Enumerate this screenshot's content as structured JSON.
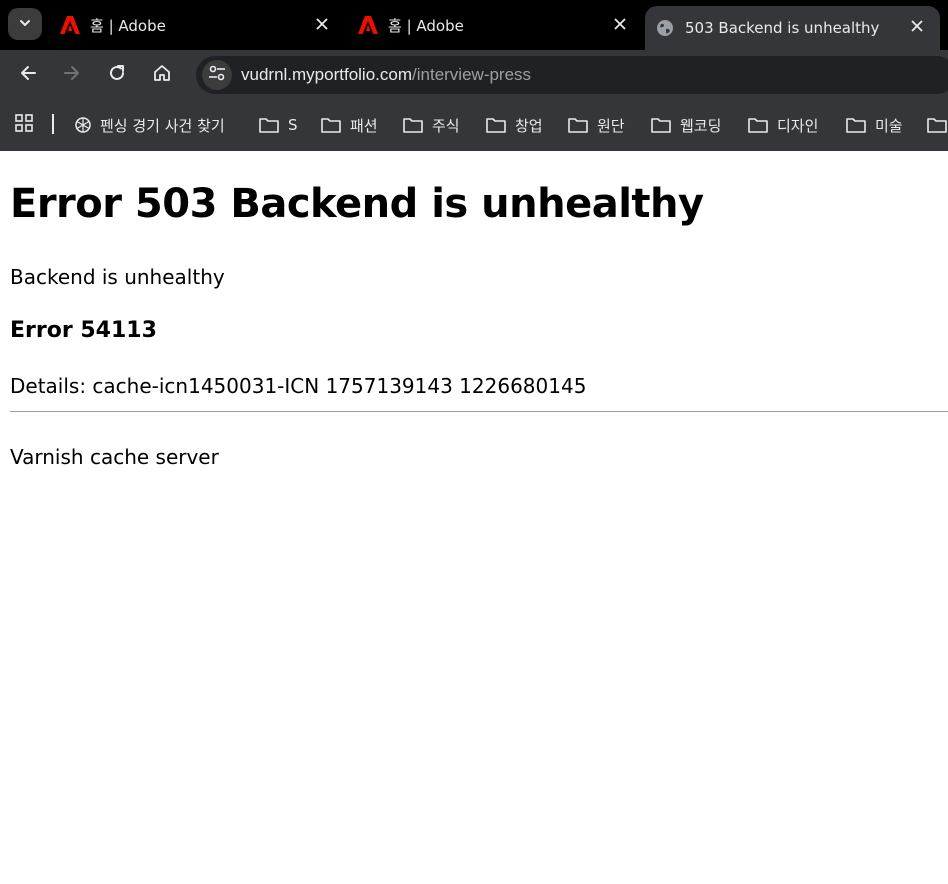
{
  "browser": {
    "tabs": [
      {
        "title": "홈 | Adobe",
        "favicon": "adobe-logo-icon",
        "active": false
      },
      {
        "title": "홈 | Adobe",
        "favicon": "adobe-logo-icon",
        "active": false
      },
      {
        "title": "503 Backend is unhealthy",
        "favicon": "globe-icon",
        "active": true
      }
    ],
    "url": {
      "host": "vudrnl.myportfolio.com",
      "path": "/interview-press"
    },
    "bookmarks": [
      {
        "label": "펜싱 경기 사건 찾기",
        "icon": "openai-icon"
      },
      {
        "label": "S",
        "icon": "folder-icon"
      },
      {
        "label": "패션",
        "icon": "folder-icon"
      },
      {
        "label": "주식",
        "icon": "folder-icon"
      },
      {
        "label": "창업",
        "icon": "folder-icon"
      },
      {
        "label": "원단",
        "icon": "folder-icon"
      },
      {
        "label": "웹코딩",
        "icon": "folder-icon"
      },
      {
        "label": "디자인",
        "icon": "folder-icon"
      },
      {
        "label": "미술",
        "icon": "folder-icon"
      }
    ],
    "colors": {
      "tabstrip": "#000000",
      "toolbar": "#35363a",
      "adobe_red": "#eb1000"
    }
  },
  "page": {
    "heading": "Error 503 Backend is unhealthy",
    "message": "Backend is unhealthy",
    "error_code": "Error 54113",
    "details": "Details: cache-icn1450031-ICN 1757139143 1226680145",
    "footer": "Varnish cache server"
  }
}
